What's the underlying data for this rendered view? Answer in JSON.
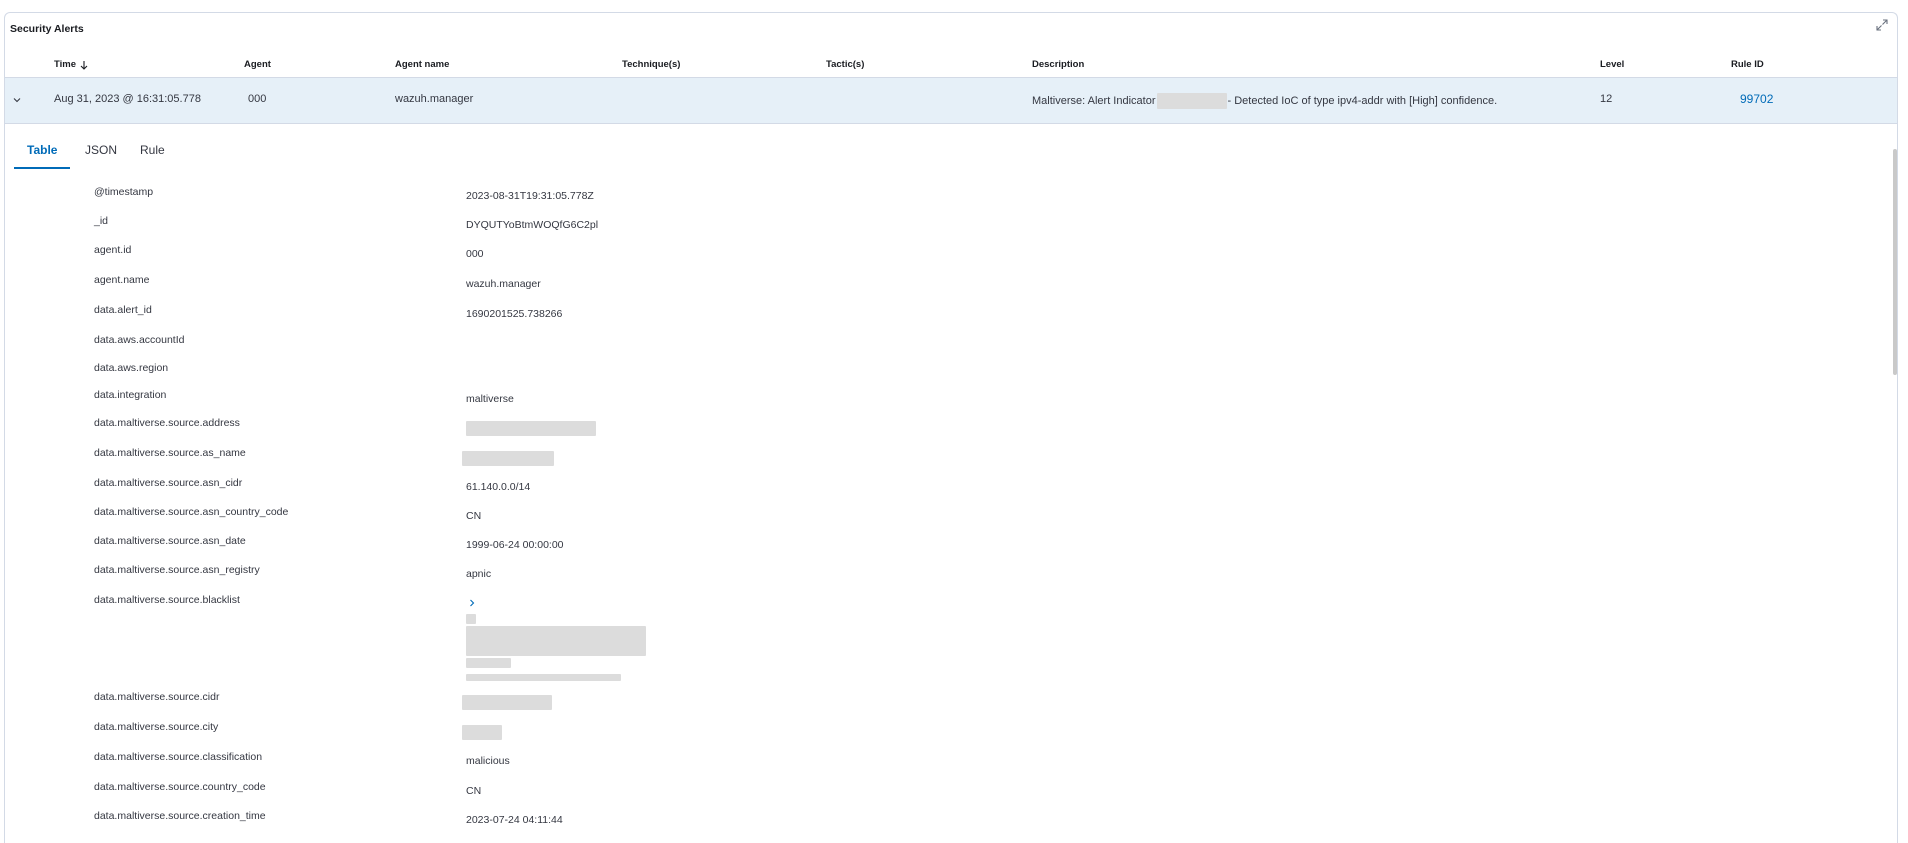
{
  "panel": {
    "title": "Security Alerts",
    "expand_icon": "fullscreen-icon"
  },
  "columns": {
    "time": "Time",
    "agent": "Agent",
    "agent_name": "Agent name",
    "techniques": "Technique(s)",
    "tactics": "Tactic(s)",
    "description": "Description",
    "level": "Level",
    "rule_id": "Rule ID"
  },
  "alert": {
    "time": "Aug 31, 2023 @ 16:31:05.778",
    "agent": "000",
    "agent_name": "wazuh.manager",
    "description_prefix": "Maltiverse: Alert Indicator",
    "description_suffix": "- Detected IoC of type ipv4-addr with [High] confidence.",
    "level": "12",
    "rule_id": "99702"
  },
  "tabs": [
    "Table",
    "JSON",
    "Rule"
  ],
  "active_tab": "Table",
  "fields": [
    {
      "name": "@timestamp",
      "value": "2023-08-31T19:31:05.778Z"
    },
    {
      "name": "_id",
      "value": "DYQUTYoBtmWOQfG6C2pl"
    },
    {
      "name": "agent.id",
      "value": "000"
    },
    {
      "name": "agent.name",
      "value": "wazuh.manager"
    },
    {
      "name": "data.alert_id",
      "value": "1690201525.738266"
    },
    {
      "name": "data.aws.accountId",
      "value": ""
    },
    {
      "name": "data.aws.region",
      "value": ""
    },
    {
      "name": "data.integration",
      "value": "maltiverse"
    },
    {
      "name": "data.maltiverse.source.address",
      "value": ""
    },
    {
      "name": "data.maltiverse.source.as_name",
      "value": ""
    },
    {
      "name": "data.maltiverse.source.asn_cidr",
      "value": "61.140.0.0/14"
    },
    {
      "name": "data.maltiverse.source.asn_country_code",
      "value": "CN"
    },
    {
      "name": "data.maltiverse.source.asn_date",
      "value": "1999-06-24 00:00:00"
    },
    {
      "name": "data.maltiverse.source.asn_registry",
      "value": "apnic"
    },
    {
      "name": "data.maltiverse.source.blacklist",
      "value": ""
    },
    {
      "name": "data.maltiverse.source.cidr",
      "value": ""
    },
    {
      "name": "data.maltiverse.source.city",
      "value": ""
    },
    {
      "name": "data.maltiverse.source.classification",
      "value": "malicious"
    },
    {
      "name": "data.maltiverse.source.country_code",
      "value": "CN"
    },
    {
      "name": "data.maltiverse.source.creation_time",
      "value": "2023-07-24 04:11:44"
    }
  ]
}
